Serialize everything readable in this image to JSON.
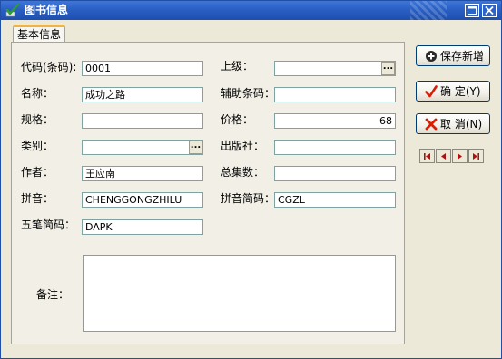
{
  "window": {
    "title": "图书信息"
  },
  "tab": {
    "label": "基本信息"
  },
  "labels": {
    "code": "代码(条码):",
    "parent": "上级：",
    "name": "名称：",
    "aux_barcode": "辅助条码：",
    "spec": "规格：",
    "price": "价格：",
    "category": "类别：",
    "publisher": "出版社：",
    "author": "作者：",
    "total_episodes": "总集数：",
    "pinyin": "拼音：",
    "pinyin_abbr": "拼音简码：",
    "wubi_abbr": "五笔简码：",
    "remarks": "备注："
  },
  "fields": {
    "code": "0001",
    "parent": "",
    "name": "成功之路",
    "aux_barcode": "",
    "spec": "",
    "price": "68",
    "category": "",
    "publisher": "",
    "author": "王应南",
    "total_episodes": "",
    "pinyin": "CHENGGONGZHILU",
    "pinyin_abbr": "CGZL",
    "wubi_abbr": "DAPK",
    "remarks": ""
  },
  "browse_label": "...",
  "buttons": {
    "save_new": "保存新增",
    "ok": "确 定(Y)",
    "cancel": "取 消(N)"
  },
  "colors": {
    "titlebar": "#2a5fc4",
    "dialog_bg": "#ece9d8",
    "field_border": "#7fa3a1",
    "ok_check": "#d81e06",
    "cancel_x": "#d81e06",
    "nav_arrow": "#b01010"
  }
}
